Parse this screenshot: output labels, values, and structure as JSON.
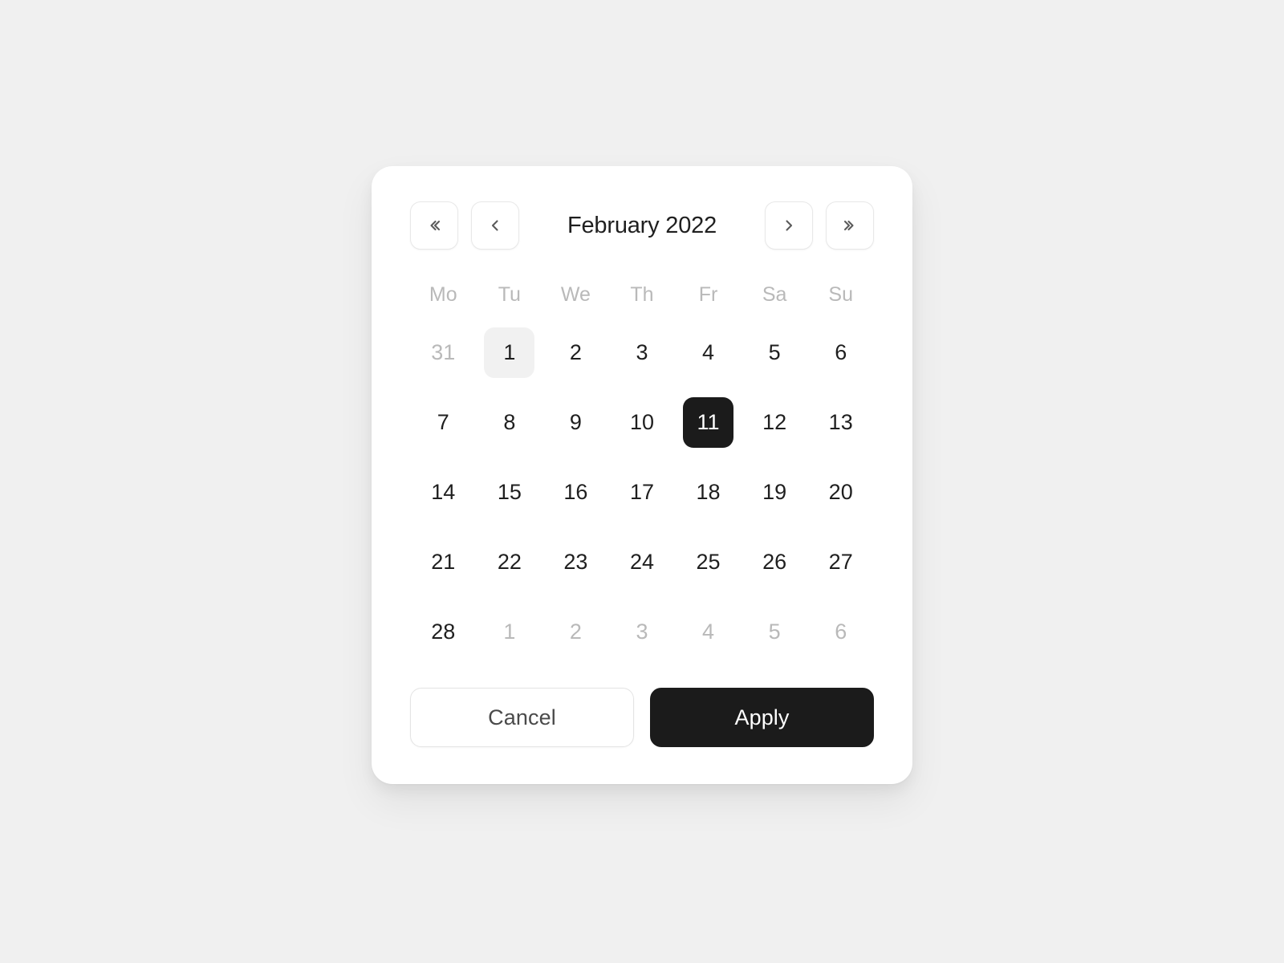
{
  "card": {
    "title": "February 2022"
  },
  "nav": {
    "prev_year": {
      "label": "«",
      "icon": "double-chevron-left-icon"
    },
    "prev_month": {
      "label": "‹",
      "icon": "chevron-left-icon"
    },
    "next_month": {
      "label": "›",
      "icon": "chevron-right-icon"
    },
    "next_year": {
      "label": "»",
      "icon": "double-chevron-right-icon"
    }
  },
  "weekdays": [
    "Mo",
    "Tu",
    "We",
    "Th",
    "Fr",
    "Sa",
    "Su"
  ],
  "days": [
    {
      "label": "31",
      "state": "muted"
    },
    {
      "label": "1",
      "state": "today"
    },
    {
      "label": "2",
      "state": "normal"
    },
    {
      "label": "3",
      "state": "normal"
    },
    {
      "label": "4",
      "state": "normal"
    },
    {
      "label": "5",
      "state": "normal"
    },
    {
      "label": "6",
      "state": "normal"
    },
    {
      "label": "7",
      "state": "normal"
    },
    {
      "label": "8",
      "state": "normal"
    },
    {
      "label": "9",
      "state": "normal"
    },
    {
      "label": "10",
      "state": "normal"
    },
    {
      "label": "11",
      "state": "selected"
    },
    {
      "label": "12",
      "state": "normal"
    },
    {
      "label": "13",
      "state": "normal"
    },
    {
      "label": "14",
      "state": "normal"
    },
    {
      "label": "15",
      "state": "normal"
    },
    {
      "label": "16",
      "state": "normal"
    },
    {
      "label": "17",
      "state": "normal"
    },
    {
      "label": "18",
      "state": "normal"
    },
    {
      "label": "19",
      "state": "normal"
    },
    {
      "label": "20",
      "state": "normal"
    },
    {
      "label": "21",
      "state": "normal"
    },
    {
      "label": "22",
      "state": "normal"
    },
    {
      "label": "23",
      "state": "normal"
    },
    {
      "label": "24",
      "state": "normal"
    },
    {
      "label": "25",
      "state": "normal"
    },
    {
      "label": "26",
      "state": "normal"
    },
    {
      "label": "27",
      "state": "normal"
    },
    {
      "label": "28",
      "state": "normal"
    },
    {
      "label": "1",
      "state": "muted"
    },
    {
      "label": "2",
      "state": "muted"
    },
    {
      "label": "3",
      "state": "muted"
    },
    {
      "label": "4",
      "state": "muted"
    },
    {
      "label": "5",
      "state": "muted"
    },
    {
      "label": "6",
      "state": "muted"
    }
  ],
  "footer": {
    "cancel_label": "Cancel",
    "apply_label": "Apply"
  },
  "colors": {
    "page_background": "#f0f0f0",
    "card_background": "#ffffff",
    "text_primary": "#1f1f1f",
    "text_muted": "#b9b9b9",
    "selected_background": "#1b1b1b",
    "selected_text": "#ffffff",
    "today_background": "#f1f1f1",
    "border": "#e8e8e8"
  }
}
